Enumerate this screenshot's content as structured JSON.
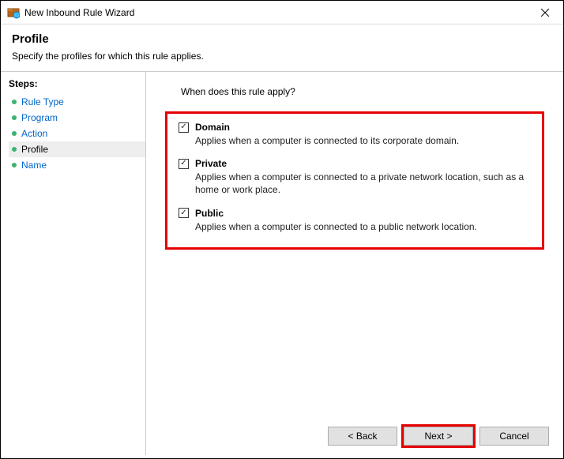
{
  "window": {
    "title": "New Inbound Rule Wizard"
  },
  "header": {
    "title": "Profile",
    "subtitle": "Specify the profiles for which this rule applies."
  },
  "sidebar": {
    "title": "Steps:",
    "items": [
      {
        "label": "Rule Type"
      },
      {
        "label": "Program"
      },
      {
        "label": "Action"
      },
      {
        "label": "Profile"
      },
      {
        "label": "Name"
      }
    ]
  },
  "content": {
    "question": "When does this rule apply?",
    "profiles": [
      {
        "label": "Domain",
        "desc": "Applies when a computer is connected to its corporate domain."
      },
      {
        "label": "Private",
        "desc": "Applies when a computer is connected to a private network location, such as a home or work place."
      },
      {
        "label": "Public",
        "desc": "Applies when a computer is connected to a public network location."
      }
    ]
  },
  "footer": {
    "back": "< Back",
    "next": "Next >",
    "cancel": "Cancel"
  }
}
